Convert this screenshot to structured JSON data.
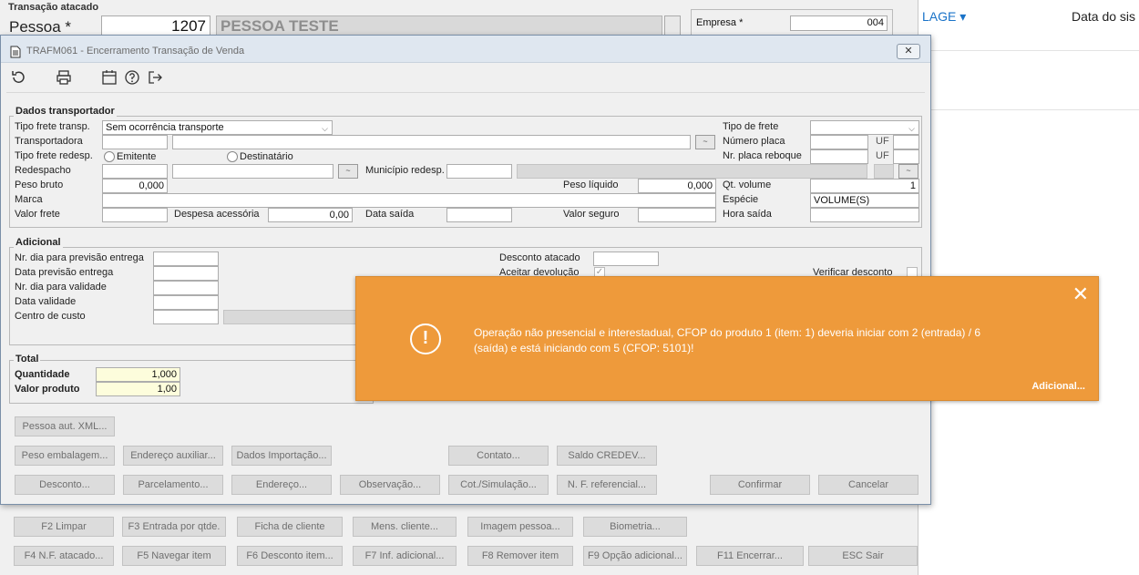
{
  "background": {
    "group_title": "Transação atacado",
    "pessoa_label": "Pessoa *",
    "pessoa_code": "1207",
    "pessoa_name": "PESSOA TESTE",
    "empresa_label": "Empresa *",
    "empresa_value": "004",
    "web_nav": "LAGE ▾",
    "web_title": "Data do sis",
    "bottom_buttons_row1": [
      "F2 Limpar",
      "F3 Entrada por qtde.",
      "Ficha de cliente",
      "Mens. cliente...",
      "Imagem pessoa...",
      "Biometria..."
    ],
    "bottom_buttons_row2": [
      "F4 N.F. atacado...",
      "F5 Navegar item",
      "F6 Desconto item...",
      "F7 Inf. adicional...",
      "F8 Remover item",
      "F9 Opção adicional...",
      "F11 Encerrar...",
      "ESC Sair"
    ]
  },
  "modal": {
    "title": "TRAFM061 - Encerramento Transação de Venda",
    "close_label": "✕",
    "transportador": {
      "title": "Dados transportador",
      "tipo_frete_transp_label": "Tipo frete transp.",
      "tipo_frete_transp_value": "Sem ocorrência transporte",
      "transportadora_label": "Transportadora",
      "tipo_frete_redesp_label": "Tipo frete redesp.",
      "emitente_label": "Emitente",
      "destinatario_label": "Destinatário",
      "redespacho_label": "Redespacho",
      "municipio_redesp_label": "Município redesp.",
      "peso_bruto_label": "Peso bruto",
      "peso_bruto_value": "0,000",
      "peso_liquido_label": "Peso líquido",
      "peso_liquido_value": "0,000",
      "marca_label": "Marca",
      "valor_frete_label": "Valor frete",
      "despesa_label": "Despesa acessória",
      "despesa_value": "0,00",
      "data_saida_label": "Data saída",
      "valor_seguro_label": "Valor seguro",
      "tipo_frete_label": "Tipo de frete",
      "numero_placa_label": "Número placa",
      "nr_placa_reboque_label": "Nr. placa reboque",
      "uf_label": "UF",
      "qt_volume_label": "Qt. volume",
      "qt_volume_value": "1",
      "especie_label": "Espécie",
      "especie_value": "VOLUME(S)",
      "hora_saida_label": "Hora saída"
    },
    "adicional": {
      "title": "Adicional",
      "nr_dia_previsao_label": "Nr. dia para previsão entrega",
      "data_previsao_label": "Data previsão entrega",
      "nr_dia_validade_label": "Nr. dia para validade",
      "data_validade_label": "Data validade",
      "centro_custo_label": "Centro de custo",
      "desconto_atacado_label": "Desconto atacado",
      "aceitar_devolucao_label": "Aceitar devolução",
      "verificar_desconto_label": "Verificar desconto"
    },
    "total": {
      "title": "Total",
      "quantidade_label": "Quantidade",
      "quantidade_value": "1,000",
      "valor_produto_label": "Valor produto",
      "valor_produto_value": "1,00"
    },
    "buttons": {
      "pessoa_aut_xml": "Pessoa aut. XML...",
      "peso_embalagem": "Peso embalagem...",
      "endereco_auxiliar": "Endereço auxiliar...",
      "dados_importacao": "Dados Importação...",
      "contato": "Contato...",
      "saldo_credev": "Saldo CREDEV...",
      "desconto": "Desconto...",
      "parcelamento": "Parcelamento...",
      "endereco": "Endereço...",
      "observacao": "Observação...",
      "cot_simulacao": "Cot./Simulação...",
      "nf_referencial": "N. F. referencial...",
      "confirmar": "Confirmar",
      "cancelar": "Cancelar"
    }
  },
  "notification": {
    "close": "✕",
    "icon": "!",
    "message": "Operação não presencial e interestadual, CFOP do produto 1 (item: 1) deveria iniciar com 2 (entrada) / 6 (saída) e está iniciando com 5 (CFOP: 5101)!",
    "link": "Adicional..."
  }
}
